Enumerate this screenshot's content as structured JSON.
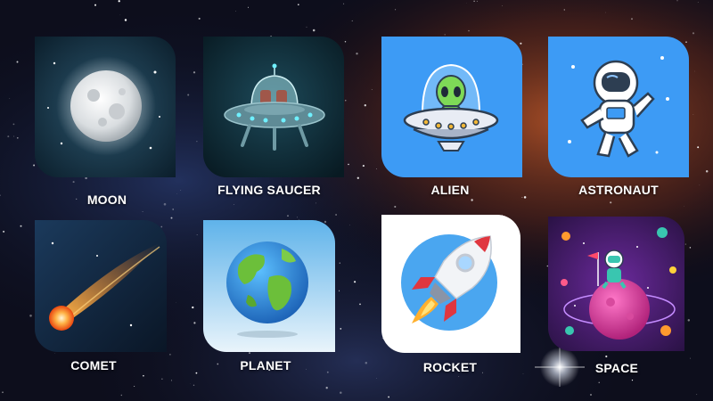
{
  "colors": {
    "tile_blue": "#3d9bf5",
    "label_text": "#ffffff"
  },
  "cards": [
    {
      "label": "MOON",
      "icon": "moon-icon"
    },
    {
      "label": "FLYING SAUCER",
      "icon": "flying-saucer-icon"
    },
    {
      "label": "ALIEN",
      "icon": "alien-icon"
    },
    {
      "label": "ASTRONAUT",
      "icon": "astronaut-icon"
    },
    {
      "label": "COMET",
      "icon": "comet-icon"
    },
    {
      "label": "PLANET",
      "icon": "planet-icon"
    },
    {
      "label": "ROCKET",
      "icon": "rocket-icon"
    },
    {
      "label": "SPACE",
      "icon": "space-scene-icon"
    }
  ]
}
